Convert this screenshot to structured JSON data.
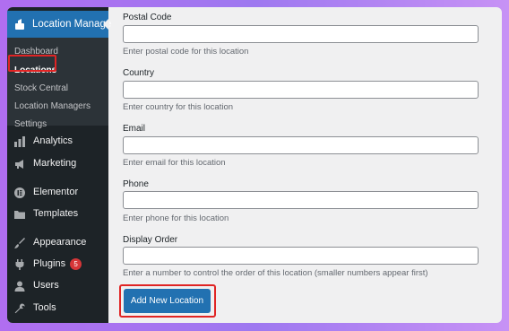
{
  "sidebar": {
    "plugin_menu": {
      "label": "Location Manage",
      "icon": "location-plugin-icon"
    },
    "submenu": [
      {
        "label": "Dashboard",
        "active": false
      },
      {
        "label": "Locations",
        "active": true
      },
      {
        "label": "Stock Central",
        "active": false
      },
      {
        "label": "Location Managers",
        "active": false
      },
      {
        "label": "Settings",
        "active": false
      }
    ],
    "items": [
      {
        "label": "Analytics",
        "icon": "analytics-icon"
      },
      {
        "label": "Marketing",
        "icon": "megaphone-icon"
      },
      {
        "label": "Elementor",
        "icon": "elementor-icon"
      },
      {
        "label": "Templates",
        "icon": "folder-icon"
      },
      {
        "label": "Appearance",
        "icon": "paintbrush-icon"
      },
      {
        "label": "Plugins",
        "icon": "plugin-icon",
        "badge": "5"
      },
      {
        "label": "Users",
        "icon": "user-icon"
      },
      {
        "label": "Tools",
        "icon": "wrench-icon"
      }
    ]
  },
  "form": {
    "fields": [
      {
        "label": "Postal Code",
        "value": "",
        "help": "Enter postal code for this location"
      },
      {
        "label": "Country",
        "value": "",
        "help": "Enter country for this location"
      },
      {
        "label": "Email",
        "value": "",
        "help": "Enter email for this location"
      },
      {
        "label": "Phone",
        "value": "",
        "help": "Enter phone for this location"
      },
      {
        "label": "Display Order",
        "value": "",
        "help": "Enter a number to control the order of this location (smaller numbers appear first)"
      }
    ],
    "submit_label": "Add New Location"
  },
  "colors": {
    "accent": "#2271b1",
    "sidebar_bg": "#1d2327",
    "highlight": "#e02424",
    "badge": "#d63638"
  }
}
